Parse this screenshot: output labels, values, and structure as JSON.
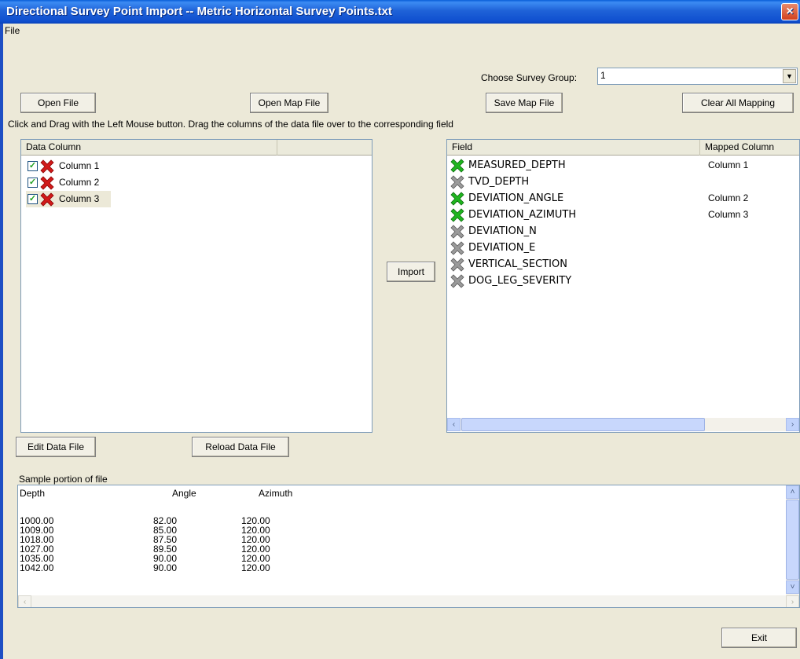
{
  "window": {
    "title": "Directional Survey Point Import -- Metric Horizontal Survey Points.txt",
    "close": "×"
  },
  "menu": {
    "file": "File"
  },
  "survey_group": {
    "label": "Choose Survey Group:",
    "value": "1"
  },
  "buttons": {
    "open_file": "Open File",
    "open_map_file": "Open Map File",
    "save_map_file": "Save Map File",
    "clear_all_mapping": "Clear All Mapping",
    "import": "Import",
    "edit_data_file": "Edit Data File",
    "reload_data_file": "Reload Data File",
    "exit": "Exit"
  },
  "instructions": "Click and Drag with the Left Mouse button. Drag the columns of the data file over to the corresponding field",
  "data_columns": {
    "header": "Data Column",
    "items": [
      {
        "label": "Column 1",
        "checked": true,
        "status": "red"
      },
      {
        "label": "Column 2",
        "checked": true,
        "status": "red"
      },
      {
        "label": "Column 3",
        "checked": true,
        "status": "red"
      }
    ]
  },
  "fields": {
    "header_field": "Field",
    "header_mapped": "Mapped Column",
    "items": [
      {
        "name": "MEASURED_DEPTH",
        "mapped": "Column 1",
        "status": "green"
      },
      {
        "name": "TVD_DEPTH",
        "mapped": "",
        "status": "gray"
      },
      {
        "name": "DEVIATION_ANGLE",
        "mapped": "Column 2",
        "status": "green"
      },
      {
        "name": "DEVIATION_AZIMUTH",
        "mapped": "Column 3",
        "status": "green"
      },
      {
        "name": "DEVIATION_N",
        "mapped": "",
        "status": "gray"
      },
      {
        "name": "DEVIATION_E",
        "mapped": "",
        "status": "gray"
      },
      {
        "name": "VERTICAL_SECTION",
        "mapped": "",
        "status": "gray"
      },
      {
        "name": "DOG_LEG_SEVERITY",
        "mapped": "",
        "status": "gray"
      }
    ]
  },
  "sample": {
    "label": "Sample portion of file",
    "headers": [
      "Depth",
      "Angle",
      "Azimuth"
    ],
    "rows": [
      [
        "1000.00",
        "82.00",
        "120.00"
      ],
      [
        "1009.00",
        "85.00",
        "120.00"
      ],
      [
        "1018.00",
        "87.50",
        "120.00"
      ],
      [
        "1027.00",
        "89.50",
        "120.00"
      ],
      [
        "1035.00",
        "90.00",
        "120.00"
      ],
      [
        "1042.00",
        "90.00",
        "120.00"
      ]
    ]
  },
  "colors": {
    "status_green": "#1fb51f",
    "status_red": "#d11a1a",
    "status_gray": "#9a9a9a"
  }
}
